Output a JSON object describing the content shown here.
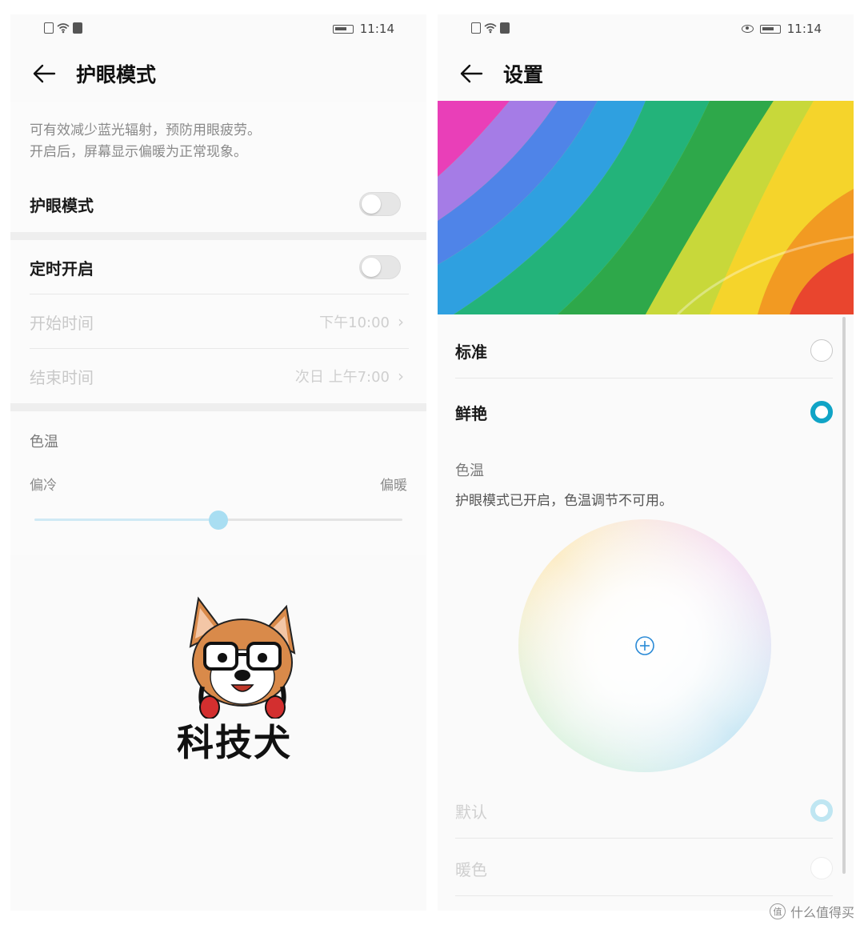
{
  "left": {
    "status": {
      "time": "11:14"
    },
    "title": "护眼模式",
    "description": [
      "可有效减少蓝光辐射，预防用眼疲劳。",
      "开启后，屏幕显示偏暖为正常现象。"
    ],
    "eye_mode_label": "护眼模式",
    "eye_mode_on": false,
    "schedule_label": "定时开启",
    "schedule_on": false,
    "start_time": {
      "label": "开始时间",
      "value": "下午10:00"
    },
    "end_time": {
      "label": "结束时间",
      "value": "次日 上午7:00"
    },
    "color_temp": {
      "title": "色温",
      "cold": "偏冷",
      "warm": "偏暖",
      "level": 0.5
    },
    "mascot_text": "科技犬"
  },
  "right": {
    "status": {
      "time": "11:14"
    },
    "title": "设置",
    "modes": [
      {
        "label": "标准",
        "selected": false
      },
      {
        "label": "鲜艳",
        "selected": true
      }
    ],
    "color_temp_title": "色温",
    "color_temp_note": "护眼模式已开启，色温调节不可用。",
    "presets": [
      {
        "label": "默认",
        "selected": true
      },
      {
        "label": "暖色",
        "selected": false
      }
    ]
  },
  "watermark": "值 什么值得买",
  "colors": {
    "accent": "#10a4c6",
    "slider_thumb": "#a9def2"
  },
  "icons": [
    "back-arrow-icon",
    "sim-icon",
    "wifi-icon",
    "battery-icon",
    "eye-icon",
    "chevron-right-icon",
    "crosshair-icon"
  ]
}
